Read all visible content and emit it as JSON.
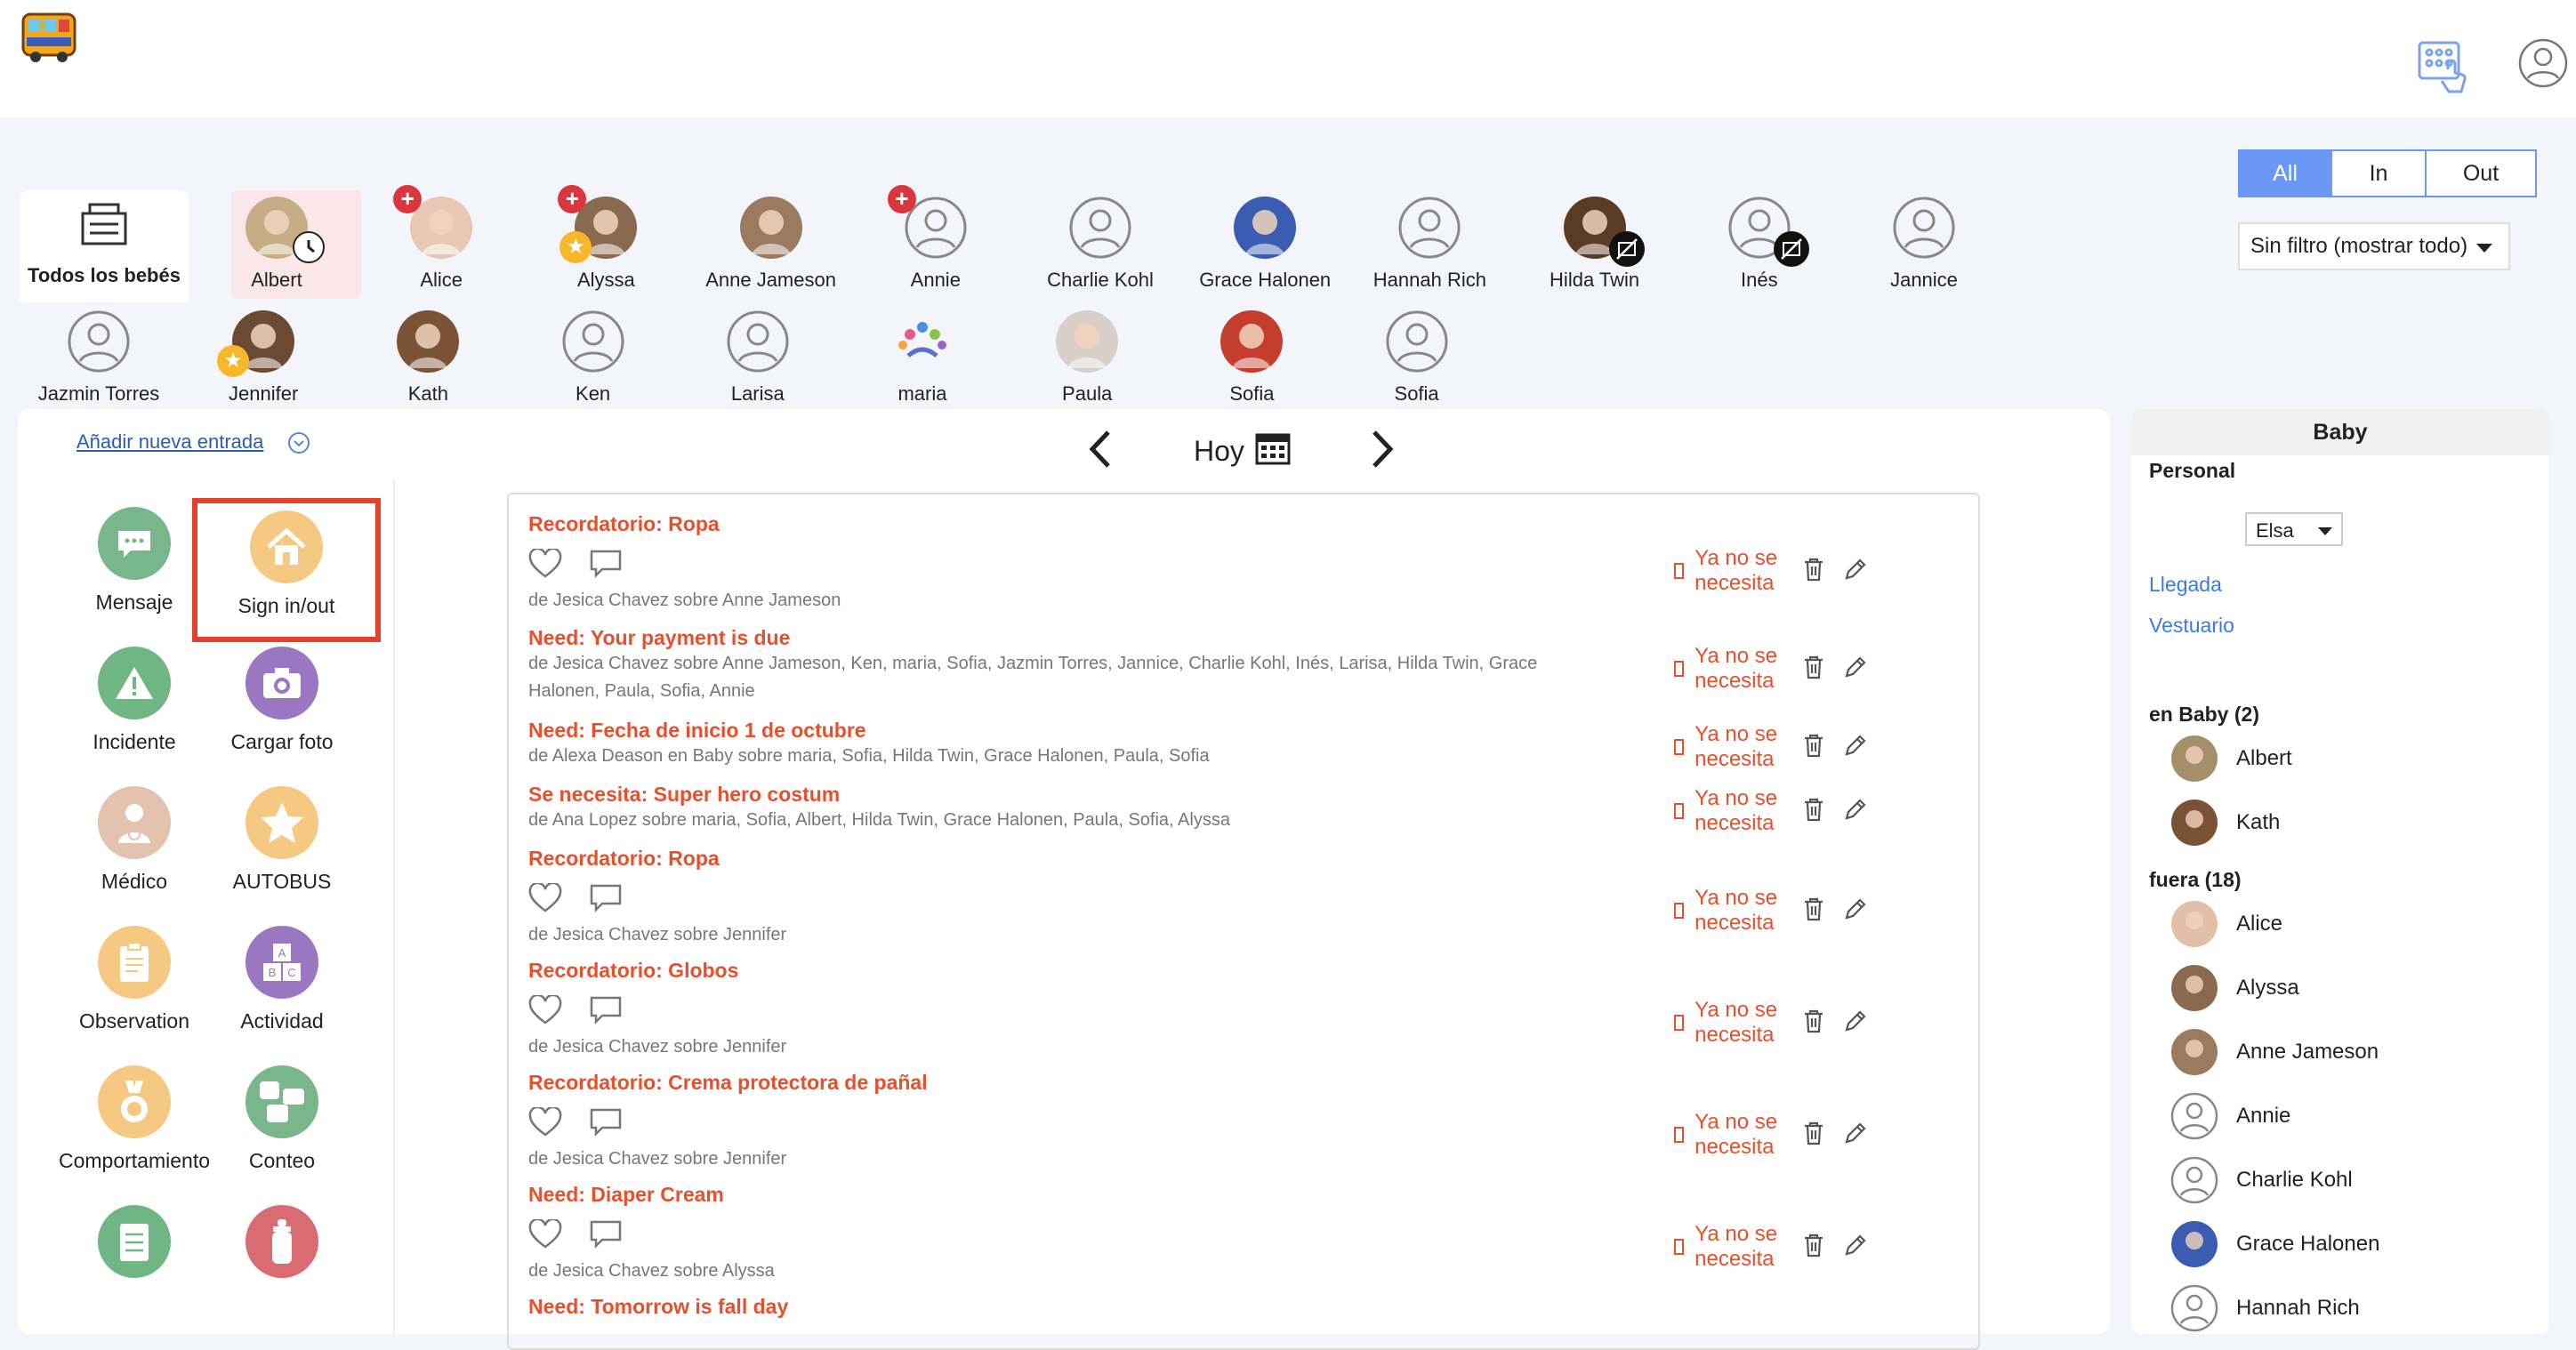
{
  "header": {
    "logo_text": "MAGIC BUS"
  },
  "filters": {
    "segments": [
      {
        "label": "All",
        "active": true
      },
      {
        "label": "In",
        "active": false
      },
      {
        "label": "Out",
        "active": false
      }
    ],
    "select_value": "Sin filtro (mostrar todo)"
  },
  "children": {
    "all_label": "Todos los bebés",
    "row1": [
      "Albert",
      "Alice",
      "Alyssa",
      "Anne Jameson",
      "Annie",
      "Charlie Kohl",
      "Grace Halonen",
      "Hannah Rich",
      "Hilda Twin",
      "Inés",
      "Jannice"
    ],
    "row2": [
      "Jazmin Torres",
      "Jennifer",
      "Kath",
      "Ken",
      "Larisa",
      "maria",
      "Paula",
      "Sofia",
      "Sofia"
    ]
  },
  "main": {
    "add_entry": "Añadir nueva entrada",
    "date_label": "Hoy",
    "tiles": [
      {
        "label": "Mensaje",
        "color": "#79b68c",
        "icon": "chat-icon"
      },
      {
        "label": "Sign in/out",
        "color": "#f6c983",
        "icon": "home-icon"
      },
      {
        "label": "Incidente",
        "color": "#6fb684",
        "icon": "warning-icon"
      },
      {
        "label": "Cargar foto",
        "color": "#9a78c1",
        "icon": "camera-icon"
      },
      {
        "label": "Médico",
        "color": "#e3c2b0",
        "icon": "doctor-icon"
      },
      {
        "label": "AUTOBUS",
        "color": "#f6c983",
        "icon": "star-icon"
      },
      {
        "label": "Observation",
        "color": "#f6c983",
        "icon": "clipboard-icon"
      },
      {
        "label": "Actividad",
        "color": "#9a78c1",
        "icon": "blocks-icon"
      },
      {
        "label": "Comportamiento",
        "color": "#f6c983",
        "icon": "medal-icon"
      },
      {
        "label": "Conteo",
        "color": "#79b68c",
        "icon": "faces-icon"
      },
      {
        "label": "",
        "color": "#6fb684",
        "icon": "checklist-icon"
      },
      {
        "label": "",
        "color": "#d96b72",
        "icon": "bottle-icon"
      }
    ],
    "no_longer_needed": "Ya no se necesita",
    "entries": [
      {
        "title": "Recordatorio: Ropa",
        "by": "de Jesica Chavez sobre Anne Jameson",
        "actions": true
      },
      {
        "title": "Need: Your payment is due",
        "by": "de Jesica Chavez sobre Anne Jameson, Ken, maria, Sofia, Jazmin Torres, Jannice, Charlie Kohl, Inés, Larisa, Hilda Twin, Grace Halonen, Paula, Sofia, Annie",
        "actions": false
      },
      {
        "title": "Need: Fecha de inicio 1 de octubre",
        "by": "de Alexa Deason en Baby sobre maria, Sofia, Hilda Twin, Grace Halonen, Paula, Sofia",
        "actions": false
      },
      {
        "title": "Se necesita: Super hero costum",
        "by": "de Ana Lopez sobre maria, Sofia, Albert, Hilda Twin, Grace Halonen, Paula, Sofia, Alyssa",
        "actions": false
      },
      {
        "title": "Recordatorio: Ropa",
        "by": "de Jesica Chavez sobre Jennifer",
        "actions": true
      },
      {
        "title": "Recordatorio: Globos",
        "by": "de Jesica Chavez sobre Jennifer",
        "actions": true
      },
      {
        "title": "Recordatorio: Crema protectora de pañal",
        "by": "de Jesica Chavez sobre Jennifer",
        "actions": true
      },
      {
        "title": "Need: Diaper Cream",
        "by": "de Jesica Chavez sobre Alyssa",
        "actions": true
      },
      {
        "title": "Need: Tomorrow is fall day",
        "by": "",
        "actions": false
      }
    ]
  },
  "sidebar": {
    "title": "Baby",
    "personal_label": "Personal",
    "staff_select": "Elsa",
    "links": [
      "Llegada",
      "Vestuario"
    ],
    "in_label": "en Baby (2)",
    "in_list": [
      "Albert",
      "Kath"
    ],
    "out_label": "fuera (18)",
    "out_list": [
      "Alice",
      "Alyssa",
      "Anne Jameson",
      "Annie",
      "Charlie Kohl",
      "Grace Halonen",
      "Hannah Rich"
    ]
  }
}
